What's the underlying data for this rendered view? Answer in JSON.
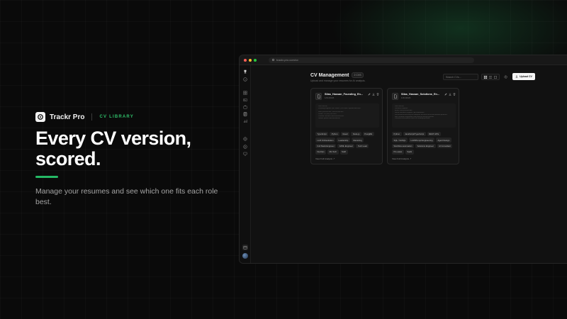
{
  "hero": {
    "brand_name": "Trackr Pro",
    "brand_tag": "CV LIBRARY",
    "headline_line1": "Every CV version,",
    "headline_line2": "scored.",
    "subtitle": "Manage your resumes and see which one fits each role best.",
    "accent_color": "#25b865"
  },
  "browser": {
    "url": "trackr-pro.com/cv",
    "traffic_lights": [
      "#ff5f57",
      "#febc2e",
      "#28c840"
    ]
  },
  "sidebar": {
    "icons": [
      "trophy-icon",
      "info-icon",
      "grid-icon",
      "id-card-icon",
      "briefcase-icon",
      "document-icon",
      "bar-chart-icon",
      "globe-icon",
      "settings-icon",
      "monitor-icon",
      "calendar-icon",
      "avatar"
    ]
  },
  "main": {
    "title": "CV Management",
    "badge": "2 CVS",
    "subtitle": "Upload and manage your resumes for AI analysis.",
    "search_placeholder": "Search CVs...",
    "upload_label": "Upload CV"
  },
  "cards": [
    {
      "name": "Silas_Hassan_Founding_En...",
      "date": "1/21/2026",
      "preview": [
        "Silas Hassan",
        "Founding Engineer | AI Product | Full Stack Systems Architect",
        "",
        "Silas@hassan.dev | silashassan.dev",
        "Phone: +1 (555) 010-2345",
        "LinkedIn: linkedin.com/in/silashassan",
        "GitHub: github.com/silashassan"
      ],
      "tags": [
        "TypeScript",
        "Python",
        "React",
        "Node.js",
        "PostgRE",
        "LLM Orchestration",
        "Leadership",
        "Mentoring",
        "Full Stack Engineer",
        "AI/ML Engineer",
        "Tech Lead",
        "DevOps",
        "ML Tech",
        "Swift"
      ],
      "link": "View Full Analysis"
    },
    {
      "name": "Silas_Hassan_Solutions_En...",
      "date": "1/21/2026",
      "preview": [
        "Silas Hassan",
        "Solutions Engineer",
        "Email: silas@hassan.dev",
        "Senior Solutions Engineer | AI Enablement",
        "Led technical discovery for enterprise accounts across AI workflow platforms",
        "Built customer integrations and proof-of-concept systems",
        "Partnered with product teams on roadmap priorities"
      ],
      "tags": [
        "Python",
        "JavaScript/TypeScript",
        "REST APIs",
        "SQL / NoSQL",
        "LLM/Prompt Engineering",
        "Agent Design",
        "Workflow automation",
        "Solutions Engineer",
        "AI Consultant",
        "Pre-sales",
        "SaaS"
      ],
      "link": "View Full Analysis"
    }
  ]
}
